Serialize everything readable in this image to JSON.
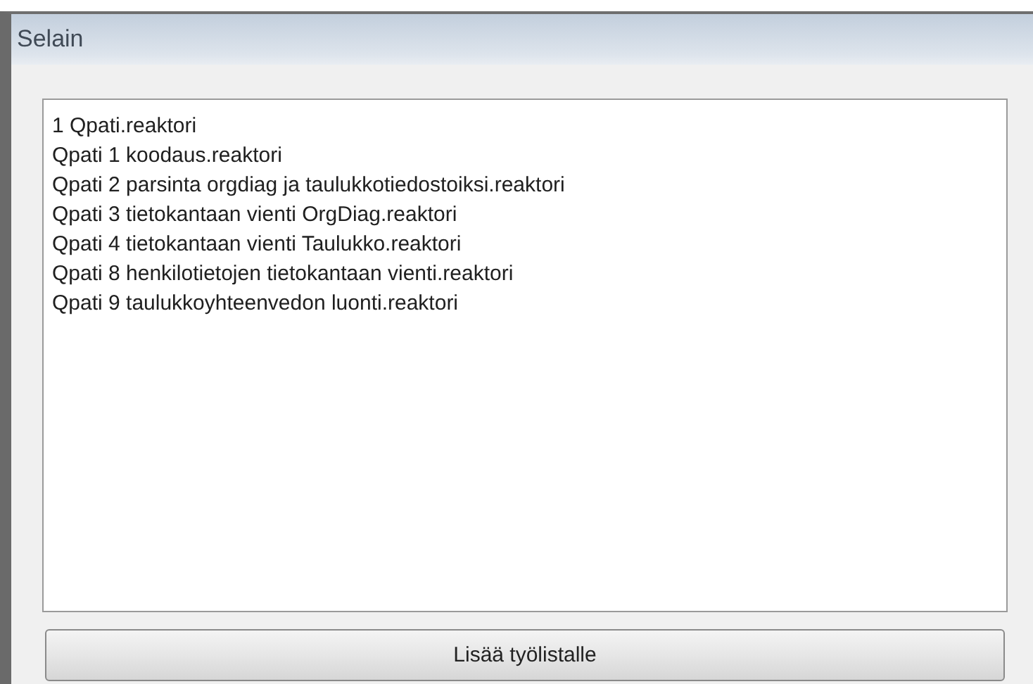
{
  "panel": {
    "title": "Selain"
  },
  "list": {
    "items": [
      "1 Qpati.reaktori",
      "Qpati 1 koodaus.reaktori",
      "Qpati 2 parsinta orgdiag ja taulukkotiedostoiksi.reaktori",
      "Qpati 3 tietokantaan vienti OrgDiag.reaktori",
      "Qpati 4 tietokantaan vienti Taulukko.reaktori",
      "Qpati 8 henkilotietojen tietokantaan vienti.reaktori",
      "Qpati 9 taulukkoyhteenvedon luonti.reaktori"
    ]
  },
  "button": {
    "label": "Lisää työlistalle"
  }
}
